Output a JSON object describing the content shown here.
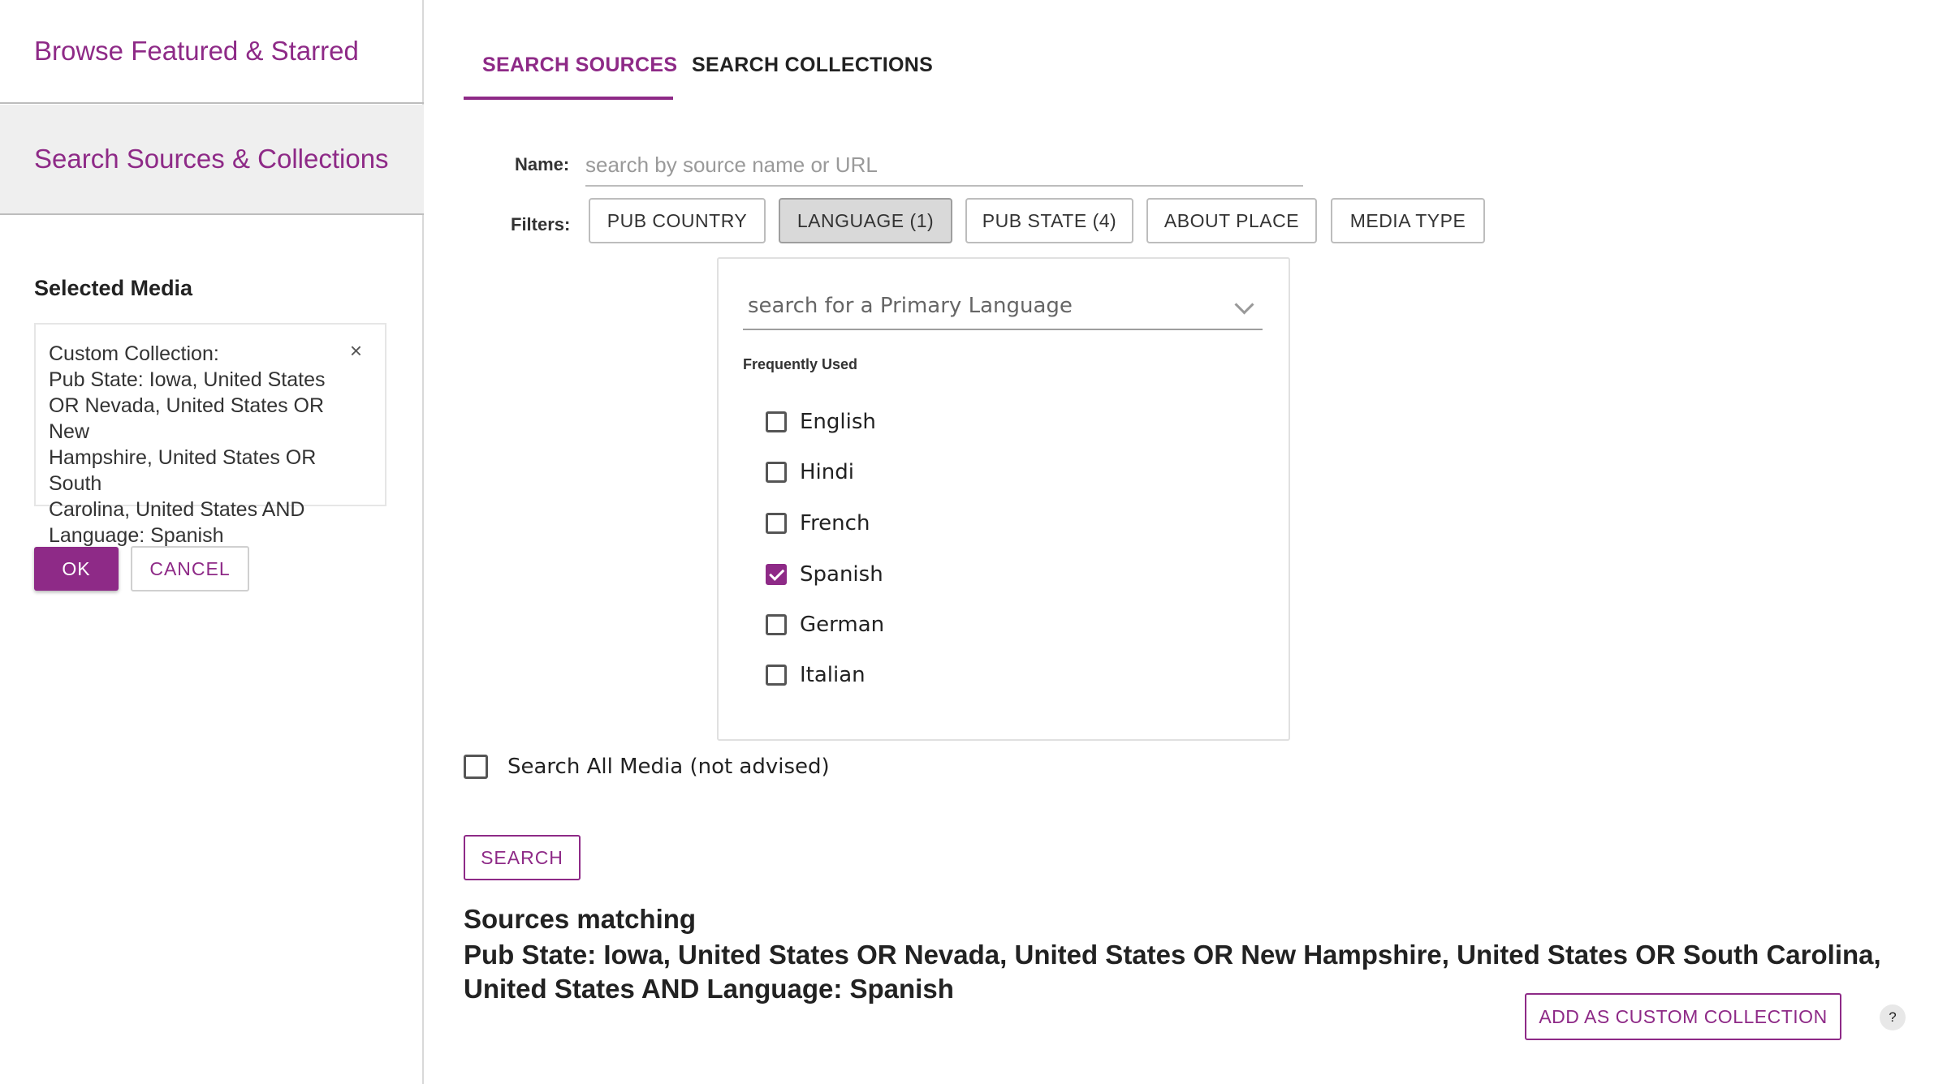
{
  "sidebar": {
    "nav": [
      {
        "label": "Browse Featured & Starred"
      },
      {
        "label": "Search Sources & Collections"
      }
    ],
    "selected_media_title": "Selected Media",
    "selected_card": {
      "lines": [
        "Custom Collection:",
        "Pub State: Iowa, United States",
        "OR Nevada, United States OR New",
        "Hampshire, United States OR South",
        "Carolina, United States AND",
        "Language: Spanish"
      ],
      "close_glyph": "×"
    },
    "ok_label": "OK",
    "cancel_label": "CANCEL"
  },
  "tabs": [
    {
      "label": "SEARCH SOURCES",
      "active": true
    },
    {
      "label": "SEARCH COLLECTIONS",
      "active": false
    }
  ],
  "name_field": {
    "label": "Name:",
    "placeholder": "search by source name or URL",
    "value": ""
  },
  "filters": {
    "label": "Filters:",
    "buttons": [
      {
        "label": "PUB COUNTRY",
        "active": false
      },
      {
        "label": "LANGUAGE (1)",
        "active": true
      },
      {
        "label": "PUB STATE (4)",
        "active": false
      },
      {
        "label": "ABOUT PLACE",
        "active": false
      },
      {
        "label": "MEDIA TYPE",
        "active": false
      }
    ]
  },
  "language_panel": {
    "search_placeholder": "search for a Primary Language",
    "frequently_used_label": "Frequently Used",
    "languages": [
      {
        "name": "English",
        "checked": false
      },
      {
        "name": "Hindi",
        "checked": false
      },
      {
        "name": "French",
        "checked": false
      },
      {
        "name": "Spanish",
        "checked": true
      },
      {
        "name": "German",
        "checked": false
      },
      {
        "name": "Italian",
        "checked": false
      }
    ]
  },
  "search_all": {
    "label": "Search All Media (not advised)",
    "checked": false
  },
  "search_button_label": "SEARCH",
  "results": {
    "title": "Sources matching",
    "query": "Pub State: Iowa, United States OR Nevada, United States OR New Hampshire, United States OR South Carolina, United States AND Language: Spanish"
  },
  "add_collection_label": "ADD AS CUSTOM COLLECTION",
  "help_label": "?",
  "colors": {
    "accent": "#8e2a87",
    "active_filter_bg": "#d9d9d9",
    "sidebar_active_bg": "#efefef"
  }
}
